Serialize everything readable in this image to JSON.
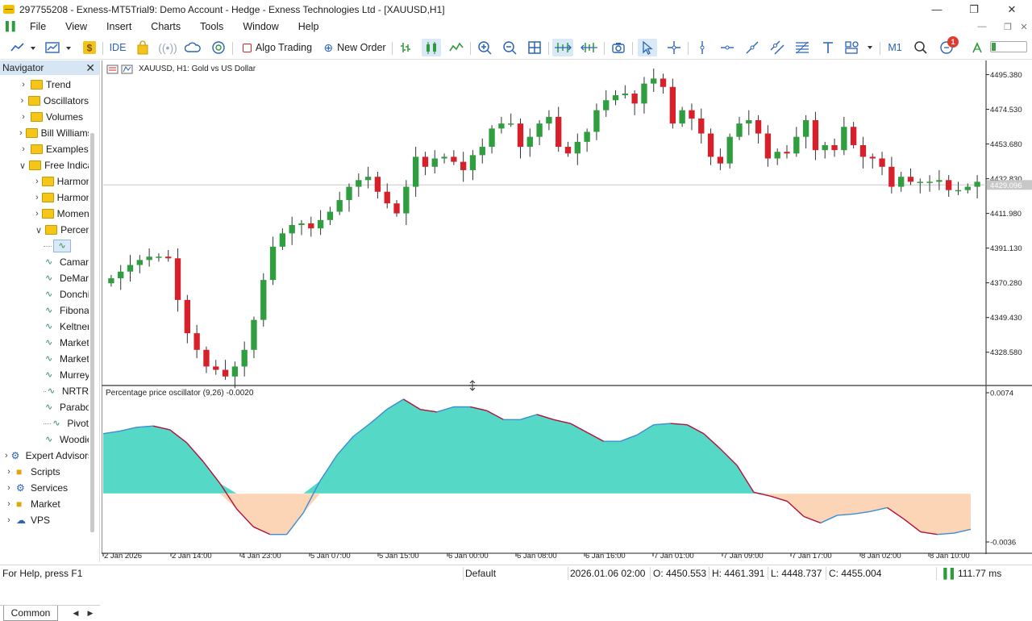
{
  "window": {
    "title": "297755208 - Exness-MT5Trial9: Demo Account - Hedge - Exness Technologies Ltd - [XAUUSD,H1]"
  },
  "menu": [
    "File",
    "View",
    "Insert",
    "Charts",
    "Tools",
    "Window",
    "Help"
  ],
  "toolbar": {
    "ide_label": "IDE",
    "algo_trading_label": "Algo Trading",
    "new_order_label": "New Order",
    "timeframe_label": "M1",
    "notification_count": "1"
  },
  "navigator": {
    "title": "Navigator",
    "items": [
      {
        "label": "Trend",
        "kind": "folder",
        "level": 1,
        "arrow": "›"
      },
      {
        "label": "Oscillators",
        "kind": "folder",
        "level": 1,
        "arrow": "›"
      },
      {
        "label": "Volumes",
        "kind": "folder",
        "level": 1,
        "arrow": "›"
      },
      {
        "label": "Bill Williams",
        "kind": "folder",
        "level": 1,
        "arrow": "›"
      },
      {
        "label": "Examples",
        "kind": "folder",
        "level": 1,
        "arrow": "›"
      },
      {
        "label": "Free Indicators",
        "kind": "folder",
        "level": 1,
        "arrow": "⌄"
      },
      {
        "label": "Harmonic",
        "kind": "folder",
        "level": 2,
        "arrow": "›"
      },
      {
        "label": "Harmonic",
        "kind": "folder",
        "level": 2,
        "arrow": "›"
      },
      {
        "label": "Momentum",
        "kind": "folder",
        "level": 2,
        "arrow": "›"
      },
      {
        "label": "Percentage",
        "kind": "folder",
        "level": 2,
        "arrow": "⌄"
      },
      {
        "label": "",
        "kind": "indicator-selected",
        "level": 3,
        "arrow": ""
      },
      {
        "label": "Camarilla",
        "kind": "indicator",
        "level": 3,
        "arrow": ""
      },
      {
        "label": "DeMark",
        "kind": "indicator",
        "level": 3,
        "arrow": ""
      },
      {
        "label": "Donchian",
        "kind": "indicator",
        "level": 3,
        "arrow": ""
      },
      {
        "label": "Fibonacci",
        "kind": "indicator",
        "level": 3,
        "arrow": ""
      },
      {
        "label": "Keltner",
        "kind": "indicator",
        "level": 3,
        "arrow": ""
      },
      {
        "label": "Market",
        "kind": "indicator",
        "level": 3,
        "arrow": ""
      },
      {
        "label": "Market",
        "kind": "indicator",
        "level": 3,
        "arrow": ""
      },
      {
        "label": "Murrey",
        "kind": "indicator",
        "level": 3,
        "arrow": ""
      },
      {
        "label": "NRTR",
        "kind": "indicator",
        "level": 3,
        "arrow": ""
      },
      {
        "label": "Parabolic",
        "kind": "indicator",
        "level": 3,
        "arrow": ""
      },
      {
        "label": "Pivot",
        "kind": "indicator",
        "level": 3,
        "arrow": ""
      },
      {
        "label": "Woodie",
        "kind": "indicator",
        "level": 3,
        "arrow": ""
      },
      {
        "label": "Expert Advisors",
        "kind": "expert",
        "level": 0,
        "arrow": "›"
      },
      {
        "label": "Scripts",
        "kind": "script",
        "level": 0,
        "arrow": "›"
      },
      {
        "label": "Services",
        "kind": "service",
        "level": 0,
        "arrow": "›"
      },
      {
        "label": "Market",
        "kind": "market",
        "level": 0,
        "arrow": "›"
      },
      {
        "label": "VPS",
        "kind": "vps",
        "level": 0,
        "arrow": "›"
      }
    ],
    "tab_label": "Common"
  },
  "chart": {
    "title": "XAUUSD, H1:  Gold vs US Dollar",
    "indicator_title": "Percentage price oscillator (9,26) -0.0020",
    "current_price_label": "4429.096",
    "price_axis_labels": [
      "4495.380",
      "4474.530",
      "4453.680",
      "4432.830",
      "4411.980",
      "4391.130",
      "4370.280",
      "4349.430",
      "4328.580"
    ],
    "indicator_axis_labels": [
      "0.0074",
      "-0.0036"
    ],
    "time_labels": [
      "2 Jan 2026",
      "2 Jan 14:00",
      "4 Jan 23:00",
      "5 Jan 07:00",
      "5 Jan 15:00",
      "6 Jan 00:00",
      "6 Jan 08:00",
      "6 Jan 16:00",
      "7 Jan 01:00",
      "7 Jan 09:00",
      "7 Jan 17:00",
      "8 Jan 02:00",
      "8 Jan 10:00"
    ],
    "colors": {
      "bull": "#2e9e3e",
      "bear": "#d8202a",
      "osc_pos": "#55d9c6",
      "osc_neg": "#fcd4b6",
      "osc_line_pos": "#3b8dd6",
      "osc_line_neg": "#b0103a"
    }
  },
  "chart_data": {
    "type": "candlestick",
    "ylim": [
      4311,
      4500
    ],
    "closes": [
      4373,
      4377,
      4381,
      4384,
      4386,
      4386,
      4385,
      4360,
      4340,
      4330,
      4320,
      4318,
      4314,
      4320,
      4330,
      4348,
      4372,
      4392,
      4400,
      4405,
      4406,
      4403,
      4408,
      4413,
      4420,
      4428,
      4432,
      4434,
      4425,
      4418,
      4412,
      4428,
      4446,
      4440,
      4445,
      4446,
      4443,
      4438,
      4447,
      4452,
      4463,
      4466,
      4466,
      4452,
      4458,
      4466,
      4470,
      4452,
      4448,
      4455,
      4461,
      4474,
      4480,
      4483,
      4484,
      4478,
      4490,
      4493,
      4488,
      4466,
      4474,
      4469,
      4460,
      4446,
      4442,
      4458,
      4466,
      4468,
      4460,
      4445,
      4449,
      4448,
      4458,
      4468,
      4450,
      4453,
      4450,
      4464,
      4453,
      4446,
      4445,
      4440,
      4428,
      4434,
      4431,
      4431,
      4431,
      4432,
      4426,
      4426,
      4428,
      4431
    ],
    "oscillator": {
      "name": "Percentage price oscillator (9,26)",
      "ylim": [
        -0.0036,
        0.0074
      ],
      "values": [
        0.0047,
        0.0049,
        0.0052,
        0.0053,
        0.005,
        0.004,
        0.0025,
        0.0008,
        -0.0012,
        -0.0026,
        -0.0032,
        -0.0032,
        -0.0015,
        0.001,
        0.003,
        0.0045,
        0.0055,
        0.0066,
        0.0074,
        0.0066,
        0.0064,
        0.0068,
        0.0068,
        0.0065,
        0.0058,
        0.0058,
        0.0062,
        0.0058,
        0.0055,
        0.0048,
        0.0041,
        0.0041,
        0.0046,
        0.0054,
        0.0055,
        0.0054,
        0.0047,
        0.0035,
        0.0022,
        0.0001,
        -0.0002,
        -0.0006,
        -0.0018,
        -0.0023,
        -0.0017,
        -0.0016,
        -0.0014,
        -0.0011,
        -0.002,
        -0.003,
        -0.0032,
        -0.0031,
        -0.0028
      ]
    }
  },
  "status": {
    "help": "For Help, press F1",
    "profile": "Default",
    "datetime": "2026.01.06 02:00",
    "open": "O: 4450.553",
    "high": "H: 4461.391",
    "low": "L: 4448.737",
    "close": "C: 4455.004",
    "ping": "111.77 ms"
  }
}
